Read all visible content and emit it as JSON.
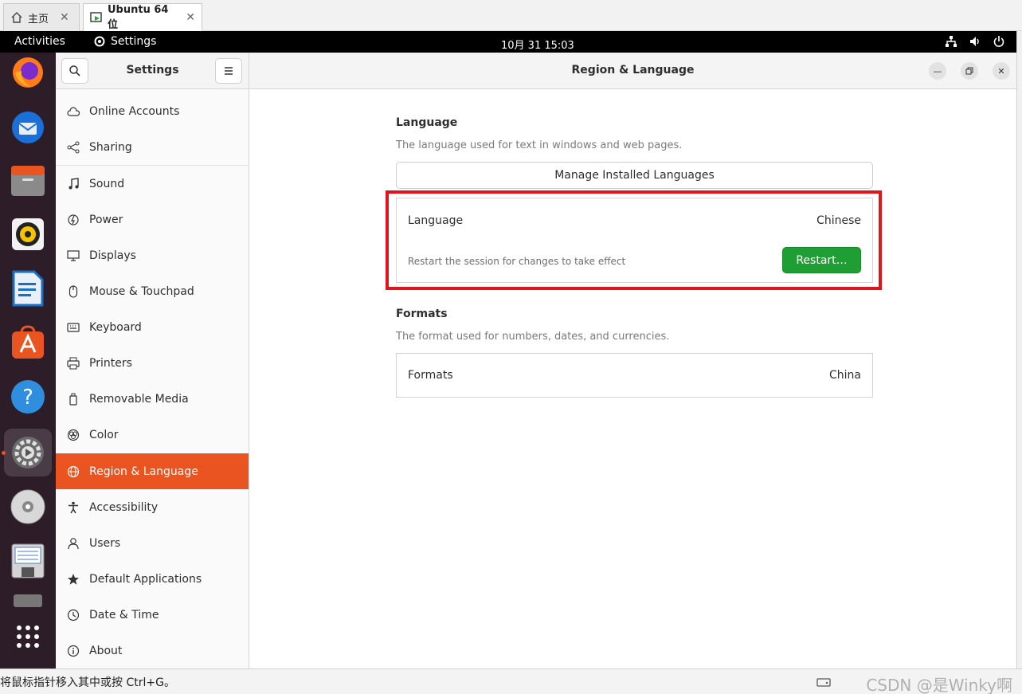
{
  "vm_tabs": [
    {
      "label": "主页",
      "icon": "home-icon"
    },
    {
      "label": "Ubuntu 64 位",
      "icon": "vm-icon"
    }
  ],
  "topbar": {
    "activities": "Activities",
    "app_name": "Settings",
    "clock": "10月 31  15:03"
  },
  "settings": {
    "sidebar_title": "Settings",
    "main_title": "Region & Language",
    "sidebar_items": [
      {
        "label": "Online Accounts",
        "icon": "cloud-icon"
      },
      {
        "label": "Sharing",
        "icon": "share-icon"
      },
      {
        "label": "Sound",
        "icon": "music-note-icon"
      },
      {
        "label": "Power",
        "icon": "power-icon"
      },
      {
        "label": "Displays",
        "icon": "display-icon"
      },
      {
        "label": "Mouse & Touchpad",
        "icon": "mouse-icon"
      },
      {
        "label": "Keyboard",
        "icon": "keyboard-icon"
      },
      {
        "label": "Printers",
        "icon": "printer-icon"
      },
      {
        "label": "Removable Media",
        "icon": "usb-drive-icon"
      },
      {
        "label": "Color",
        "icon": "color-icon"
      },
      {
        "label": "Region & Language",
        "icon": "globe-icon",
        "selected": true
      },
      {
        "label": "Accessibility",
        "icon": "accessibility-icon"
      },
      {
        "label": "Users",
        "icon": "users-icon"
      },
      {
        "label": "Default Applications",
        "icon": "star-icon"
      },
      {
        "label": "Date & Time",
        "icon": "clock-icon"
      },
      {
        "label": "About",
        "icon": "info-icon"
      }
    ]
  },
  "region": {
    "language_section": {
      "title": "Language",
      "description": "The language used for text in windows and web pages.",
      "manage_button": "Manage Installed Languages",
      "row_label": "Language",
      "row_value": "Chinese",
      "restart_note": "Restart the session for changes to take effect",
      "restart_button": "Restart…"
    },
    "formats_section": {
      "title": "Formats",
      "description": "The format used for numbers, dates, and currencies.",
      "row_label": "Formats",
      "row_value": "China"
    }
  },
  "statusbar": {
    "hint": "将鼠标指针移入其中或按 Ctrl+G。",
    "watermark": "CSDN @是Winky啊"
  },
  "colors": {
    "accent": "#e95420",
    "restart_green": "#1e9e33",
    "highlight_red": "#e1141c",
    "dock_bg": "#2d1d28"
  }
}
